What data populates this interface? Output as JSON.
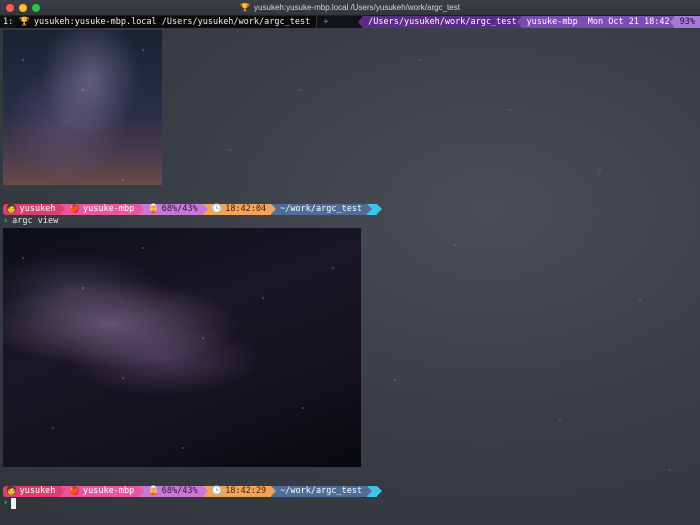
{
  "window": {
    "title": "yusukeh:yusuke-mbp.local /Users/yusukeh/work/argc_test",
    "title_icon": "🏆"
  },
  "tmux": {
    "index": "1:",
    "window_icon": "🏆",
    "window_label": "yusukeh:yusuke-mbp.local /Users/yusukeh/work/argc_test",
    "new_tab": "+",
    "right": {
      "path": "/Users/yusukeh/work/argc_test",
      "host": "yusuke-mbp",
      "datetime": "Mon Oct 21 18:42",
      "battery": "93%"
    }
  },
  "prompts": [
    {
      "user_icon": "🧑",
      "user": "yusukeh",
      "host_icon": "🍎",
      "host": "yusuke-mbp",
      "res_icon": "🧝",
      "resources": "68%/43%",
      "clock_icon": "🕒",
      "time": "18:42:04",
      "dir": "~/work/argc_test"
    },
    {
      "user_icon": "🧑",
      "user": "yusukeh",
      "host_icon": "🍎",
      "host": "yusuke-mbp",
      "res_icon": "🧝",
      "resources": "68%/43%",
      "clock_icon": "🕒",
      "time": "18:42:29",
      "dir": "~/work/argc_test"
    }
  ],
  "command": {
    "chevron": "›",
    "text": "argc view"
  },
  "input": {
    "chevron": "›"
  },
  "colors": {
    "background": "#3a3e46",
    "tmux_bar": "#111214",
    "prompt_user": "#d94070",
    "prompt_host": "#e8579e",
    "prompt_res": "#c879d8",
    "prompt_time": "#f2a55a",
    "prompt_dir": "#4f6d99",
    "prompt_end": "#3fc6e6",
    "chevron": "#58d8b8"
  }
}
